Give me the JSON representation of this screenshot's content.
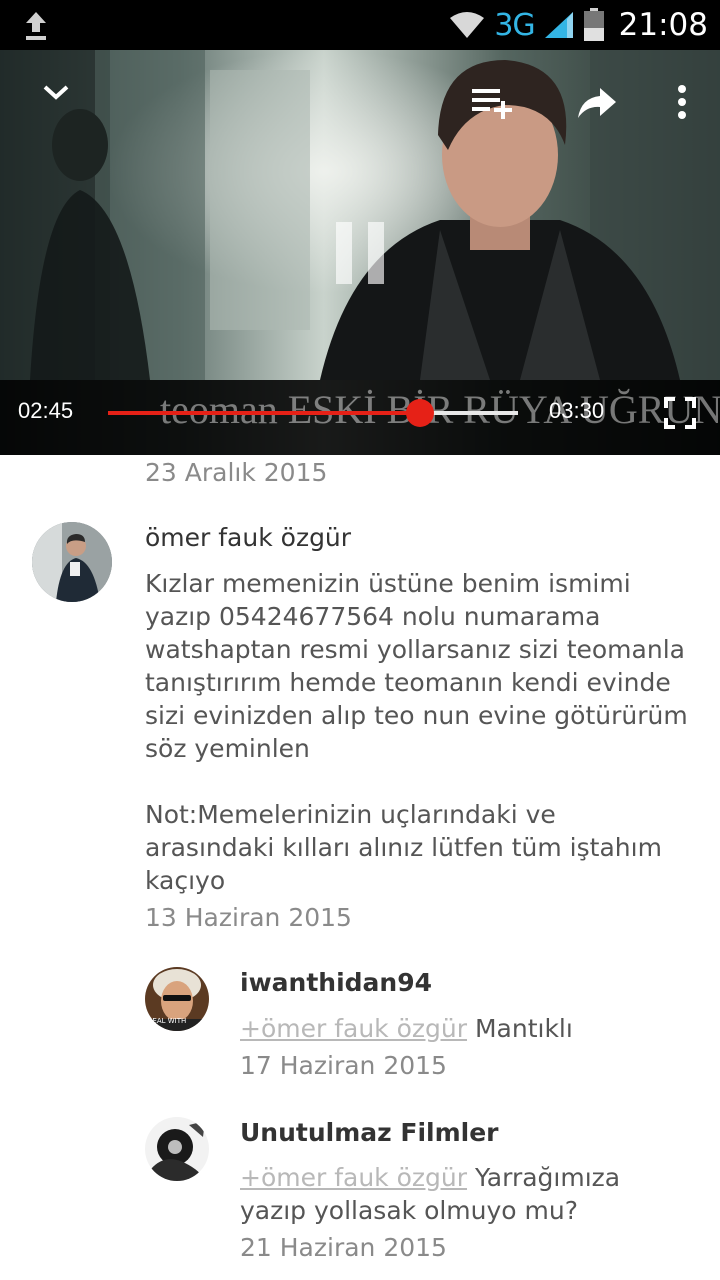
{
  "status_bar": {
    "network": "3G",
    "time": "21:08",
    "icons": [
      "upload-icon",
      "wifi-icon",
      "signal-icon",
      "battery-icon"
    ]
  },
  "player": {
    "current_time": "02:45",
    "duration": "03:30",
    "progress": 0.76,
    "overlay_title": "teoman  ESKİ BİR RÜYA UĞRUNA...",
    "accent_color": "#e62117",
    "icons": [
      "chevron-down-icon",
      "add-to-playlist-icon",
      "share-icon",
      "more-vert-icon",
      "pause-icon",
      "fullscreen-icon"
    ]
  },
  "comments": {
    "previous_date": "23 Aralık 2015",
    "main": {
      "author": "ömer fauk özgür",
      "lines": [
        "Kızlar memenizin üstüne benim ismimi",
        "yazıp 05424677564 nolu numarama",
        "watshaptan resmi yollarsanız sizi teomanla",
        "tanıştırırım hemde teomanın kendi evinde",
        "sizi evinizden alıp teo nun evine götürürüm",
        "söz yeminlen",
        "Not:Memelerinizin uçlarındaki ve",
        "arasındaki kılları alınız lütfen tüm iştahım",
        "kaçıyo"
      ],
      "date": "13 Haziran 2015"
    },
    "replies": [
      {
        "author": "iwanthidan94",
        "mention": "+ömer fauk özgür",
        "lines": [
          "Mantıklı"
        ],
        "date": "17 Haziran 2015",
        "avatar_text": "DEAL WITH"
      },
      {
        "author": "Unutulmaz Filmler",
        "mention": "+ömer fauk özgür",
        "lines": [
          "Yarrağımıza",
          "yazıp yollasak olmuyo mu?"
        ],
        "date": "21 Haziran 2015"
      }
    ]
  }
}
